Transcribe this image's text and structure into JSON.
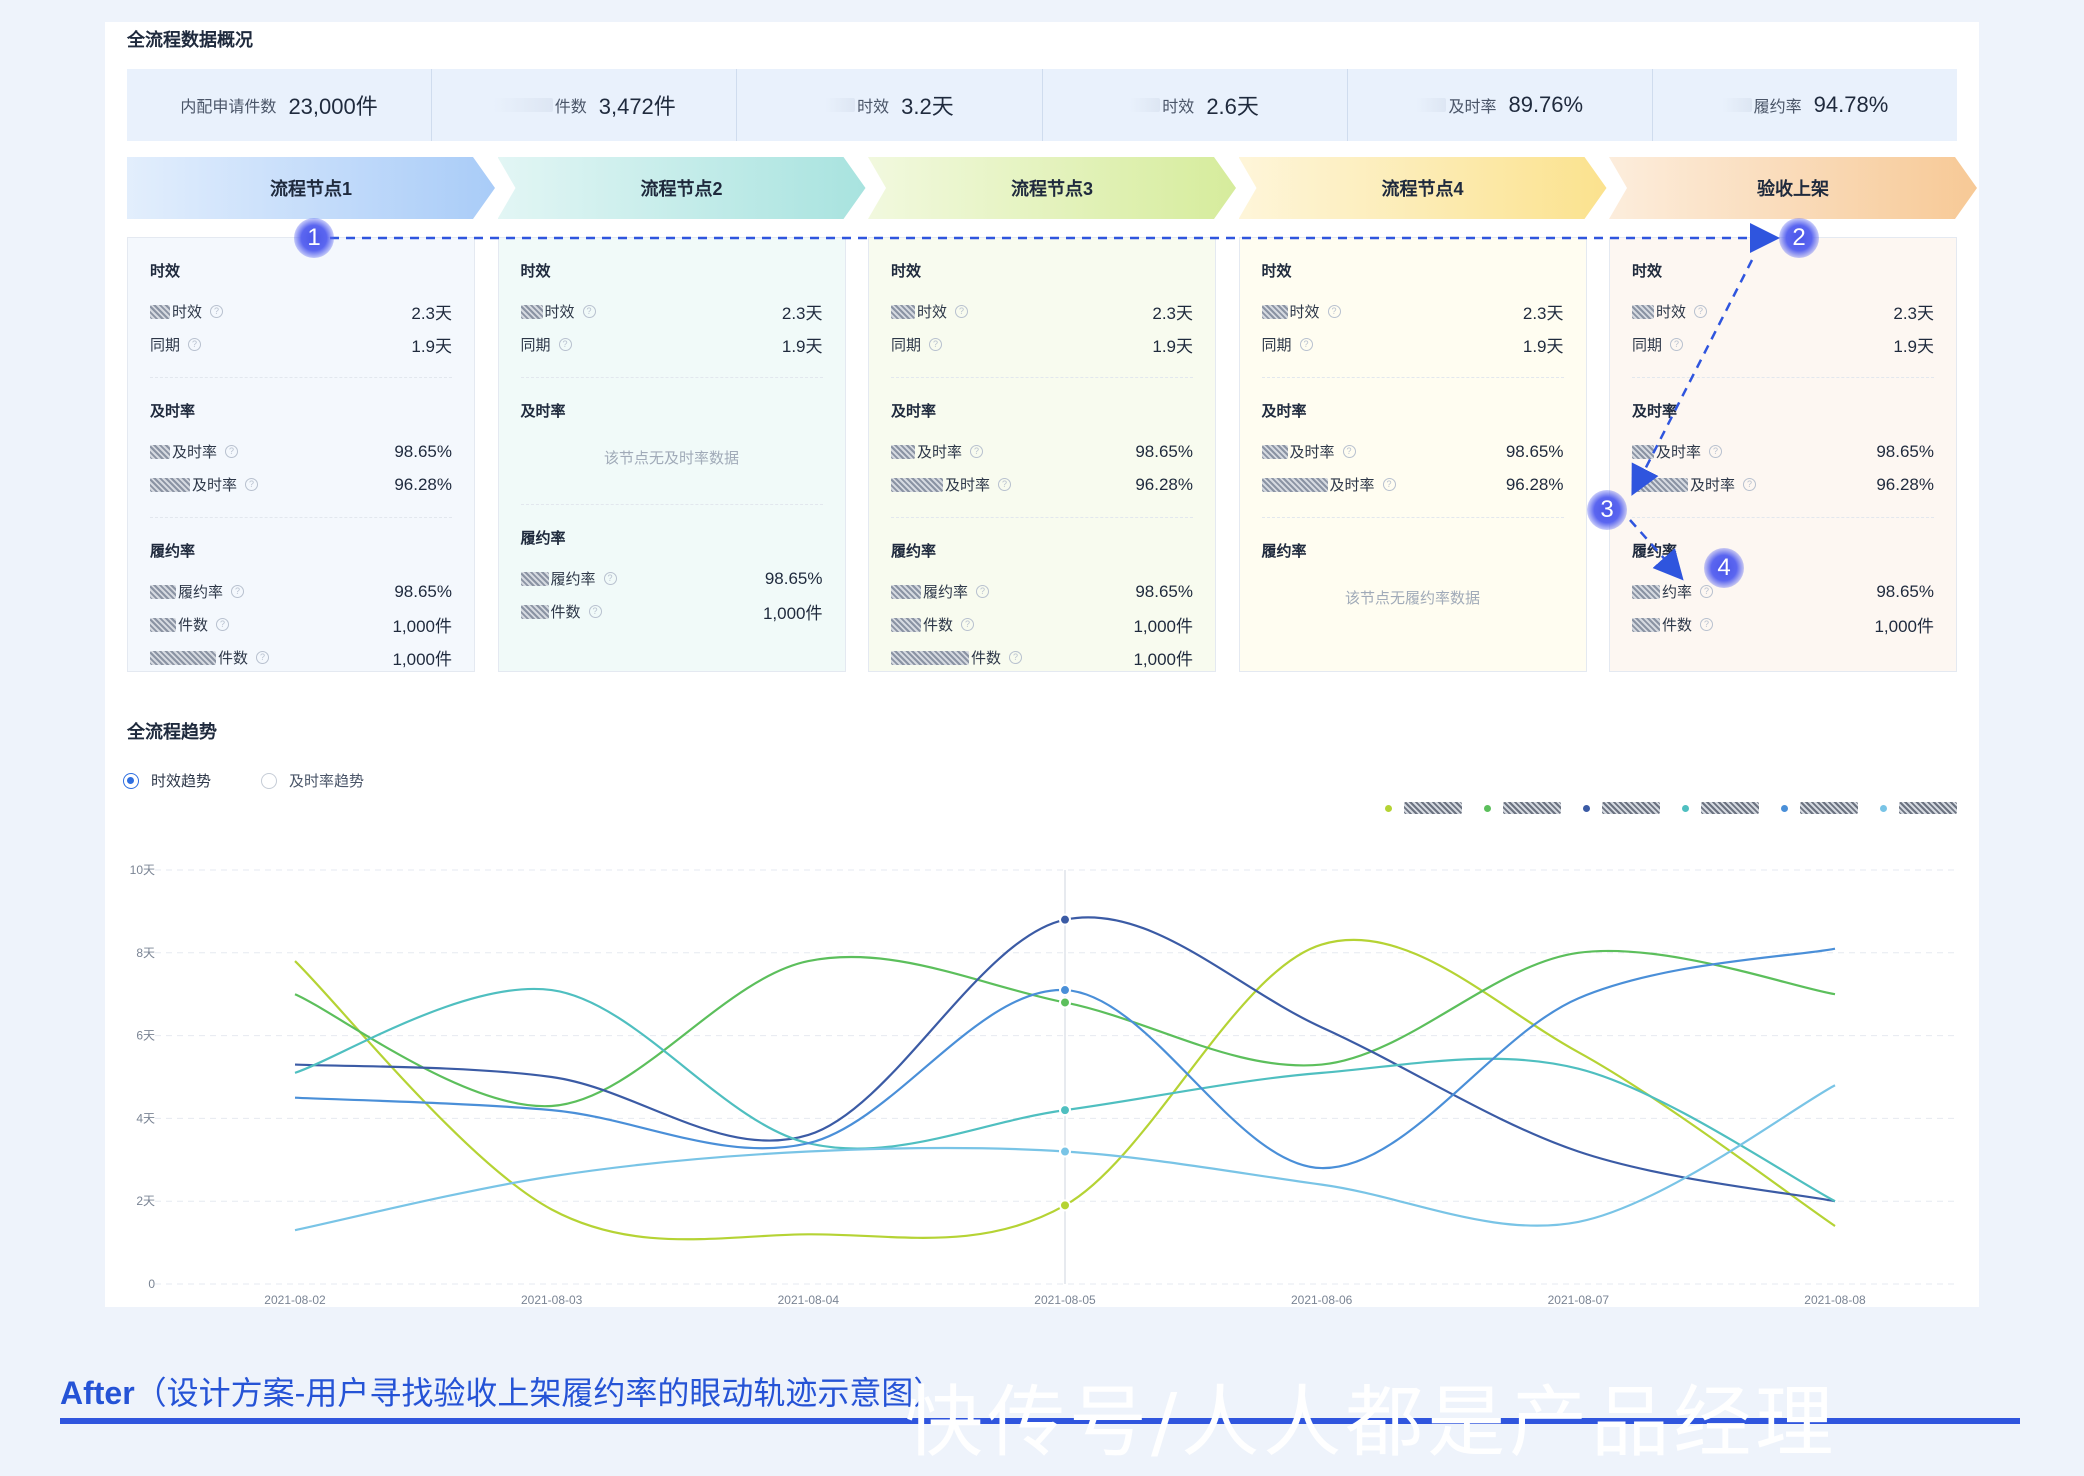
{
  "section_overview_title": "全流程数据概况",
  "overview": [
    {
      "label": "内配申请件数",
      "value": "23,000件"
    },
    {
      "label": "件数",
      "value": "3,472件"
    },
    {
      "label": "时效",
      "value": "3.2天"
    },
    {
      "label": "时效",
      "value": "2.6天"
    },
    {
      "label": "及时率",
      "value": "89.76%"
    },
    {
      "label": "履约率",
      "value": "94.78%"
    }
  ],
  "steps": [
    {
      "label": "流程节点1",
      "color": "#a9ccf8"
    },
    {
      "label": "流程节点2",
      "color": "#a8e3df"
    },
    {
      "label": "流程节点3",
      "color": "#d6ec9c"
    },
    {
      "label": "流程节点4",
      "color": "#fbe28e"
    },
    {
      "label": "验收上架",
      "color": "#f7c996"
    }
  ],
  "cards": [
    {
      "timeliness_title": "时效",
      "t1_label": "时效",
      "t1_value": "2.3天",
      "t2_label": "同期",
      "t2_value": "1.9天",
      "ontime_title": "及时率",
      "o1_label": "及时率",
      "o1_value": "98.65%",
      "o2_label": "及时率",
      "o2_value": "96.28%",
      "fulfil_title": "履约率",
      "f1_label": "履约率",
      "f1_value": "98.65%",
      "f2_label": "件数",
      "f2_value": "1,000件",
      "f3_label": "件数",
      "f3_value": "1,000件"
    },
    {
      "timeliness_title": "时效",
      "t1_label": "时效",
      "t1_value": "2.3天",
      "t2_label": "同期",
      "t2_value": "1.9天",
      "ontime_title": "及时率",
      "ontime_empty": "该节点无及时率数据",
      "fulfil_title": "履约率",
      "f1_label": "履约率",
      "f1_value": "98.65%",
      "f2_label": "件数",
      "f2_value": "1,000件"
    },
    {
      "timeliness_title": "时效",
      "t1_label": "时效",
      "t1_value": "2.3天",
      "t2_label": "同期",
      "t2_value": "1.9天",
      "ontime_title": "及时率",
      "o1_label": "及时率",
      "o1_value": "98.65%",
      "o2_label": "及时率",
      "o2_value": "96.28%",
      "fulfil_title": "履约率",
      "f1_label": "履约率",
      "f1_value": "98.65%",
      "f2_label": "件数",
      "f2_value": "1,000件",
      "f3_label": "件数",
      "f3_value": "1,000件"
    },
    {
      "timeliness_title": "时效",
      "t1_label": "时效",
      "t1_value": "2.3天",
      "t2_label": "同期",
      "t2_value": "1.9天",
      "ontime_title": "及时率",
      "o1_label": "及时率",
      "o1_value": "98.65%",
      "o2_label": "及时率",
      "o2_value": "96.28%",
      "fulfil_title": "履约率",
      "fulfil_empty": "该节点无履约率数据"
    },
    {
      "timeliness_title": "时效",
      "t1_label": "时效",
      "t1_value": "2.3天",
      "t2_label": "同期",
      "t2_value": "1.9天",
      "ontime_title": "及时率",
      "o1_label": "及时率",
      "o1_value": "98.65%",
      "o2_label": "及时率",
      "o2_value": "96.28%",
      "fulfil_title": "履约率",
      "f1_label": "约率",
      "f1_value": "98.65%",
      "f2_label": "件数",
      "f2_value": "1,000件"
    }
  ],
  "trend_title": "全流程趋势",
  "radios": [
    {
      "label": "时效趋势",
      "selected": true
    },
    {
      "label": "及时率趋势",
      "selected": false
    }
  ],
  "legend_colors": [
    "#b5d334",
    "#5cbf5c",
    "#3b5ba5",
    "#4fbfc0",
    "#4a8fd8",
    "#79c4e6"
  ],
  "badges": [
    "1",
    "2",
    "3",
    "4"
  ],
  "caption_prefix": "After",
  "caption_text": "（设计方案-用户寻找验收上架履约率的眼动轨迹示意图）",
  "watermark": "快传号/人人都是产品经理",
  "chart_data": {
    "type": "line",
    "categories": [
      "2021-08-02",
      "2021-08-03",
      "2021-08-04",
      "2021-08-05",
      "2021-08-06",
      "2021-08-07",
      "2021-08-08"
    ],
    "y_ticks": [
      "0",
      "2天",
      "4天",
      "6天",
      "8天",
      "10天"
    ],
    "ylim": [
      0,
      10
    ],
    "series": [
      {
        "color": "#b5d334",
        "values": [
          7.8,
          1.8,
          1.2,
          1.9,
          8.2,
          5.6,
          1.4
        ]
      },
      {
        "color": "#5cbf5c",
        "values": [
          7.0,
          4.3,
          7.8,
          6.8,
          5.3,
          8.0,
          7.0
        ]
      },
      {
        "color": "#3b5ba5",
        "values": [
          5.3,
          5.0,
          3.6,
          8.8,
          6.2,
          3.2,
          2.0
        ]
      },
      {
        "color": "#4fbfc0",
        "values": [
          5.1,
          7.1,
          3.4,
          4.2,
          5.1,
          5.2,
          2.0
        ]
      },
      {
        "color": "#4a8fd8",
        "values": [
          4.5,
          4.2,
          3.4,
          7.1,
          2.8,
          6.9,
          8.1
        ]
      },
      {
        "color": "#79c4e6",
        "values": [
          1.3,
          2.6,
          3.2,
          3.2,
          2.4,
          1.5,
          4.8
        ]
      }
    ],
    "highlight_category": "2021-08-05"
  }
}
